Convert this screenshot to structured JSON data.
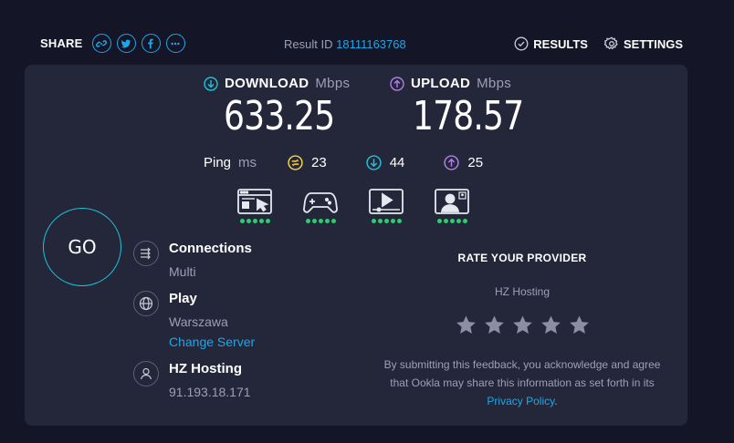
{
  "header": {
    "share_label": "SHARE",
    "share_buttons": [
      {
        "name": "link-icon"
      },
      {
        "name": "twitter-icon"
      },
      {
        "name": "facebook-icon"
      },
      {
        "name": "more-icon"
      }
    ],
    "result_prefix": "Result ID",
    "result_id": "18111163768",
    "results_label": "RESULTS",
    "settings_label": "SETTINGS"
  },
  "download": {
    "label": "DOWNLOAD",
    "unit": "Mbps",
    "value": "633.25",
    "color": "#1cc3d8"
  },
  "upload": {
    "label": "UPLOAD",
    "unit": "Mbps",
    "value": "178.57",
    "color": "#b07ee9"
  },
  "ping": {
    "label": "Ping",
    "unit": "ms",
    "idle": "23",
    "download": "44",
    "upload": "25",
    "idle_color": "#f5d34a"
  },
  "apps": [
    {
      "name": "web-browsing-icon",
      "rating": 5
    },
    {
      "name": "gaming-icon",
      "rating": 5
    },
    {
      "name": "video-streaming-icon",
      "rating": 5
    },
    {
      "name": "video-chat-icon",
      "rating": 5
    }
  ],
  "go_label": "GO",
  "connections": {
    "title": "Connections",
    "value": "Multi"
  },
  "server": {
    "title": "Play",
    "location": "Warszawa",
    "change_label": "Change Server"
  },
  "host": {
    "title": "HZ Hosting",
    "ip": "91.193.18.171"
  },
  "rate": {
    "title": "RATE YOUR PROVIDER",
    "provider": "HZ Hosting",
    "stars": 5,
    "note": "By submitting this feedback, you acknowledge and agree that Ookla may share this information as set forth in its ",
    "policy_label": "Privacy Policy",
    "note_end": "."
  },
  "colors": {
    "accent": "#1da7e8",
    "rating_dot": "#2dcc70",
    "background": "#141526",
    "panel": "#24273a"
  }
}
